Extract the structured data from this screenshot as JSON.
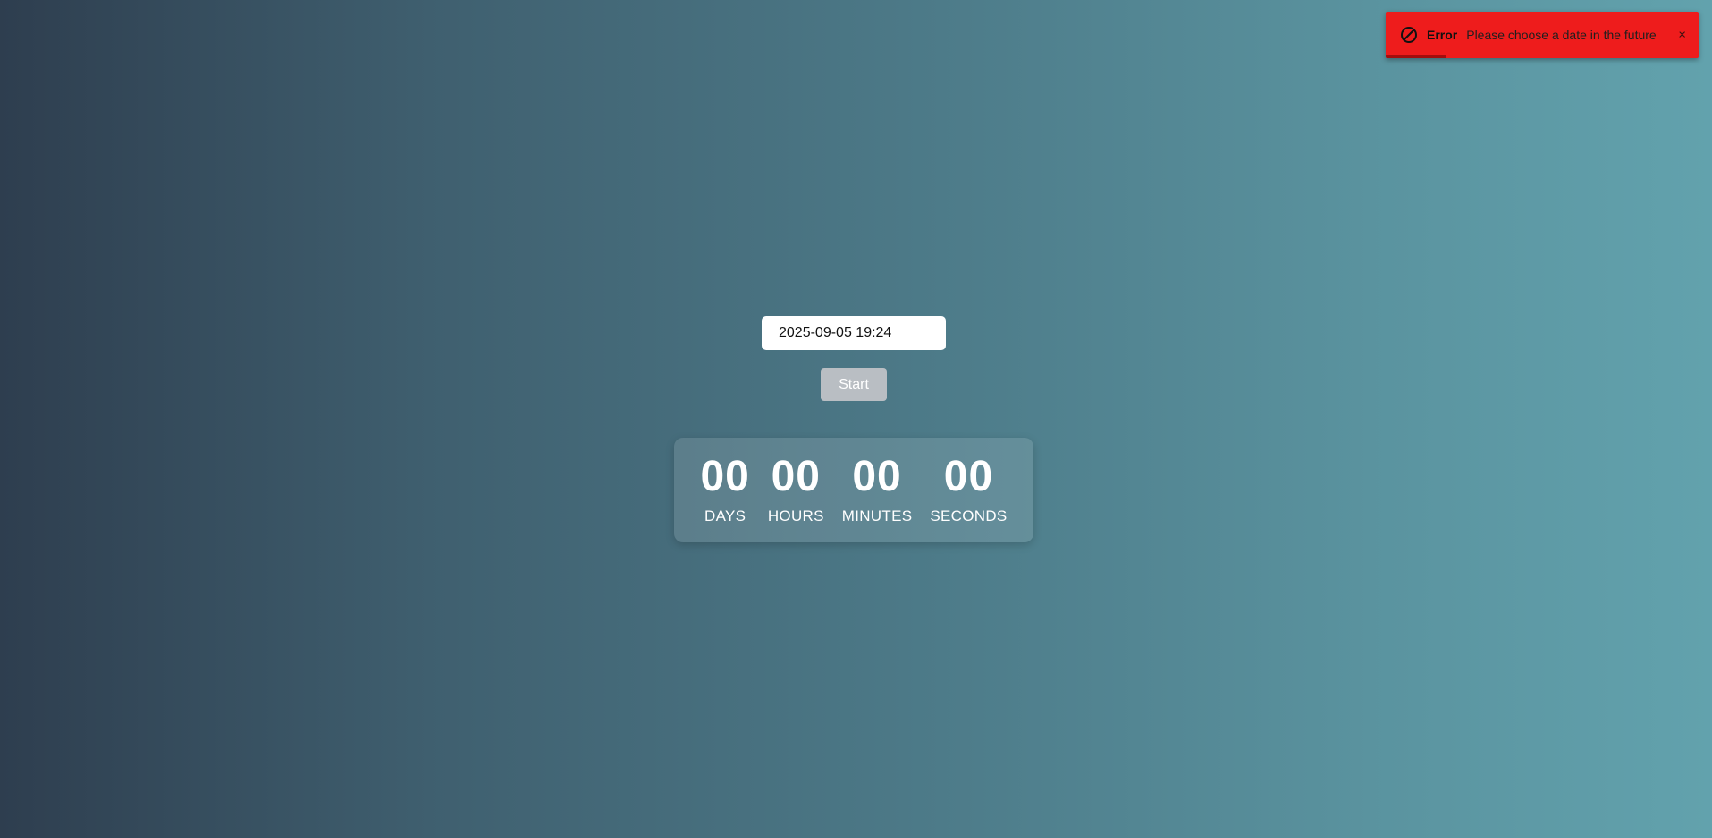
{
  "toast": {
    "icon": "blocked-icon",
    "title": "Error",
    "message": "Please choose a date in the future",
    "close_label": "×",
    "background_color": "#ee1c1c",
    "progress": 0.19
  },
  "form": {
    "date_value": "2025-09-05 19:24",
    "start_label": "Start",
    "start_button_color": "#b9bec3"
  },
  "timer": {
    "units": [
      {
        "value": "00",
        "label": "DAYS"
      },
      {
        "value": "00",
        "label": "HOURS"
      },
      {
        "value": "00",
        "label": "MINUTES"
      },
      {
        "value": "00",
        "label": "SECONDS"
      }
    ]
  },
  "background": {
    "gradient_start": "#2e3e4f",
    "gradient_end": "#62a2ad"
  }
}
